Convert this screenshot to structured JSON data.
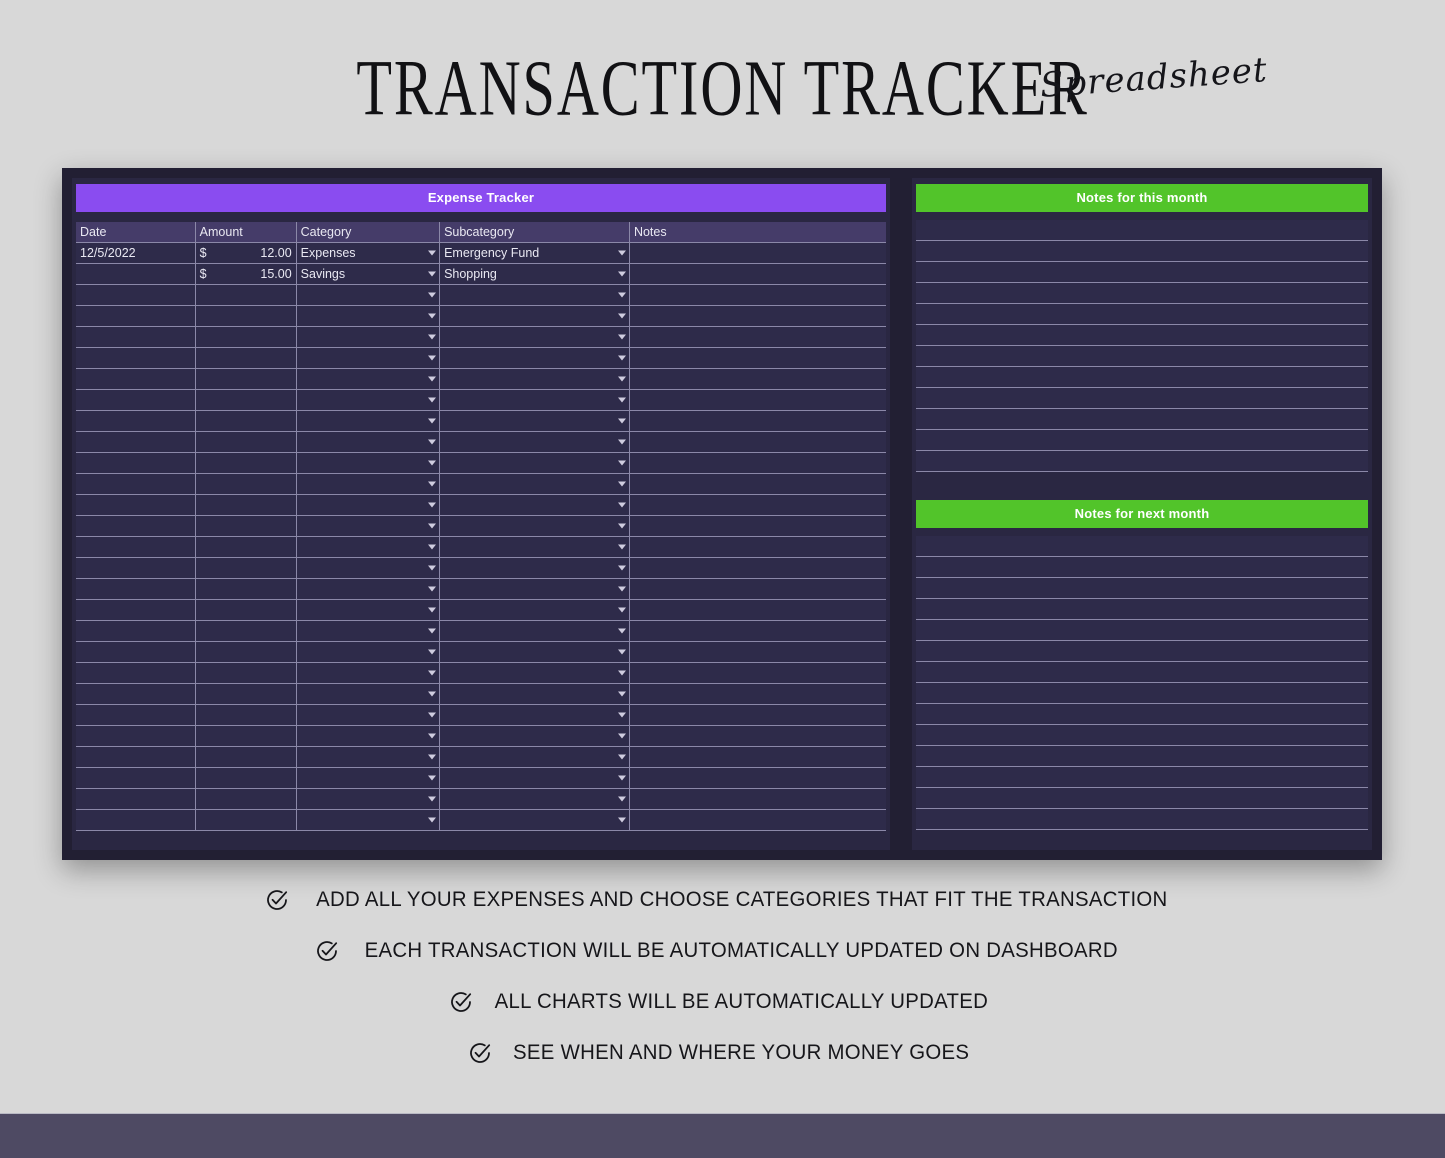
{
  "title": {
    "main": "TRANSACTION TRACKER",
    "script": "Spreadsheet"
  },
  "expense_tracker": {
    "header": "Expense Tracker",
    "columns": [
      "Date",
      "Amount",
      "Category",
      "Subcategory",
      "Notes"
    ],
    "rows": [
      {
        "date": "12/5/2022",
        "currency": "$",
        "amount": "12.00",
        "category": "Expenses",
        "subcategory": "Emergency Fund",
        "notes": ""
      },
      {
        "date": "",
        "currency": "$",
        "amount": "15.00",
        "category": "Savings",
        "subcategory": "Shopping",
        "notes": ""
      }
    ],
    "empty_row_count": 26,
    "dropdown_icon": "chevron-down-icon"
  },
  "notes_this_month": {
    "header": "Notes for this month",
    "row_count": 12,
    "rows": [
      "",
      "",
      "",
      "",
      "",
      "",
      "",
      "",
      "",
      "",
      "",
      ""
    ]
  },
  "notes_next_month": {
    "header": "Notes for next month",
    "row_count": 14,
    "rows": [
      "",
      "",
      "",
      "",
      "",
      "",
      "",
      "",
      "",
      "",
      "",
      "",
      "",
      ""
    ]
  },
  "features": [
    {
      "icon": "check-circle-icon",
      "text": "ADD ALL YOUR EXPENSES AND CHOOSE CATEGORIES THAT FIT THE TRANSACTION"
    },
    {
      "icon": "check-circle-icon",
      "text": "EACH TRANSACTION WILL BE AUTOMATICALLY UPDATED ON DASHBOARD"
    },
    {
      "icon": "check-circle-icon",
      "text": "ALL CHARTS WILL BE AUTOMATICALLY UPDATED"
    },
    {
      "icon": "check-circle-icon",
      "text": "SEE WHEN AND WHERE YOUR MONEY GOES"
    }
  ],
  "colors": {
    "background": "#d8d8d8",
    "board": "#221f33",
    "panel": "#2a2742",
    "cell": "#2e2b4a",
    "accent_purple": "#8a4cf0",
    "accent_green": "#52c42a",
    "column_header": "#453c69",
    "grid_line": "#8b88a8",
    "bottom_bar": "#4e4a63",
    "text_light": "#e9e8f2",
    "text_dark": "#16161a"
  }
}
